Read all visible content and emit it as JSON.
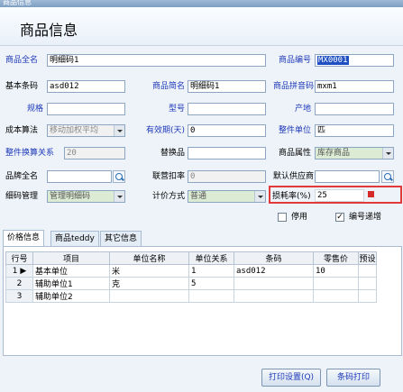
{
  "window": {
    "title": "商品信息"
  },
  "header": {
    "title": "商品信息"
  },
  "form": {
    "full_name": {
      "label": "商品全名",
      "value": "明细码1"
    },
    "code": {
      "label": "商品编号",
      "value": "MX0001"
    },
    "barcode": {
      "label": "基本条码",
      "value": "asd012"
    },
    "short_name": {
      "label": "商品简名",
      "value": "明细码1"
    },
    "pinyin": {
      "label": "商品拼音码",
      "value": "mxm1"
    },
    "spec": {
      "label": "规格",
      "value": ""
    },
    "model": {
      "label": "型号",
      "value": ""
    },
    "origin": {
      "label": "产地",
      "value": ""
    },
    "cost_method": {
      "label": "成本算法",
      "value": "移动加权平均"
    },
    "validity": {
      "label": "有效期(天)",
      "value": "0"
    },
    "whole_unit": {
      "label": "整件单位",
      "value": "匹"
    },
    "whole_ratio": {
      "label": "整件换算关系",
      "value": "20"
    },
    "substitute": {
      "label": "替换品",
      "value": ""
    },
    "attribute": {
      "label": "商品属性",
      "value": "库存商品"
    },
    "brand": {
      "label": "品牌全名",
      "value": ""
    },
    "joint_rate": {
      "label": "联营扣率",
      "value": "0"
    },
    "default_supplier": {
      "label": "默认供应商",
      "value": ""
    },
    "detail_mgmt": {
      "label": "细码管理",
      "value": "管理明细码"
    },
    "pricing": {
      "label": "计价方式",
      "value": "普通"
    },
    "loss_rate": {
      "label": "损耗率(%)",
      "value": "25"
    },
    "disable": {
      "label": "停用",
      "checked": false
    },
    "code_increment": {
      "label": "编号递增",
      "checked": true
    }
  },
  "tabs": [
    "价格信息",
    "商品teddy",
    "其它信息"
  ],
  "table": {
    "headers": [
      "行号",
      "项目",
      "单位名称",
      "单位关系",
      "条码",
      "零售价",
      "预设"
    ],
    "rows": [
      {
        "no": "1",
        "item": "基本单位",
        "unit": "米",
        "ratio": "1",
        "barcode": "asd012",
        "retail": "10",
        "preset": ""
      },
      {
        "no": "2",
        "item": "辅助单位1",
        "unit": "克",
        "ratio": "5",
        "barcode": "",
        "retail": "",
        "preset": ""
      },
      {
        "no": "3",
        "item": "辅助单位2",
        "unit": "",
        "ratio": "",
        "barcode": "",
        "retail": "",
        "preset": ""
      }
    ]
  },
  "buttons": {
    "print_settings": "打印设置(Q)",
    "barcode_print": "条码打印"
  }
}
